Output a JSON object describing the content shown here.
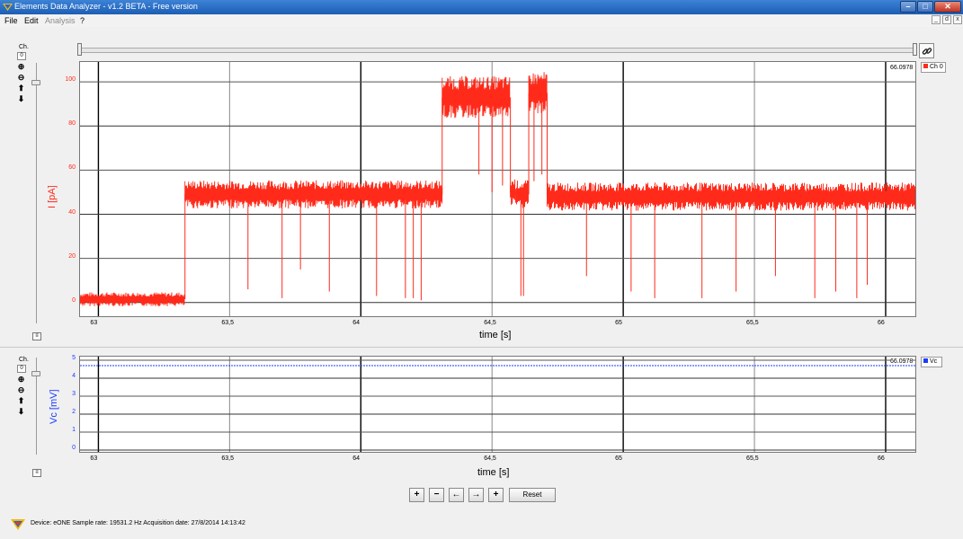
{
  "window": {
    "title": "Elements Data Analyzer - v1.2 BETA - Free version",
    "minimize": "–",
    "maximize": "□",
    "close": "✕"
  },
  "menu": [
    {
      "label": "File",
      "enabled": true
    },
    {
      "label": "Edit",
      "enabled": true
    },
    {
      "label": "Analysis",
      "enabled": false
    },
    {
      "label": "?",
      "enabled": true
    }
  ],
  "mdi": {
    "minimize": "_",
    "restore": "d",
    "close": "x"
  },
  "range_slider": {
    "link_icon": "link-icon"
  },
  "top_plot": {
    "channel_label": "Ch.",
    "channel_number": "0",
    "readout": "66.0978",
    "legend": "Ch 0",
    "color": "#ff2a1a",
    "corner_icon": "≡",
    "chart_data": {
      "type": "line",
      "xlabel": "time [s]",
      "ylabel": "I [pA]",
      "xlim": [
        62.93,
        66.12
      ],
      "ylim": [
        -7,
        109
      ],
      "xticks": [
        63,
        63.5,
        64,
        64.5,
        65,
        65.5,
        66
      ],
      "xtick_labels": [
        "63",
        "63,5",
        "64",
        "64,5",
        "65",
        "65,5",
        "66"
      ],
      "yticks": [
        0,
        20,
        40,
        60,
        80,
        100
      ],
      "ytick_labels": [
        "0",
        "20",
        "40",
        "60",
        "80",
        "100"
      ],
      "grid": true,
      "legend_position": "top-right",
      "series": [
        {
          "name": "Ch 0",
          "color": "#ff2a1a",
          "segments": [
            {
              "x": [
                62.93,
                63.33
              ],
              "level": 1.5,
              "noise": 2
            },
            {
              "x": [
                63.33,
                64.31
              ],
              "level": 49,
              "noise": 4
            },
            {
              "x": [
                64.31,
                64.57
              ],
              "level": 93,
              "noise": 6
            },
            {
              "x": [
                64.57,
                64.59
              ],
              "level": 50,
              "noise": 4
            },
            {
              "x": [
                64.59,
                64.64
              ],
              "level": 49,
              "noise": 4
            },
            {
              "x": [
                64.64,
                64.71
              ],
              "level": 95,
              "noise": 6
            },
            {
              "x": [
                64.71,
                66.12
              ],
              "level": 48,
              "noise": 4
            }
          ],
          "spikes": [
            {
              "x": 63.57,
              "y": 6
            },
            {
              "x": 63.7,
              "y": 2
            },
            {
              "x": 63.77,
              "y": 15
            },
            {
              "x": 63.88,
              "y": 5
            },
            {
              "x": 64.06,
              "y": 3
            },
            {
              "x": 64.17,
              "y": 2
            },
            {
              "x": 64.2,
              "y": 2
            },
            {
              "x": 64.23,
              "y": 1
            },
            {
              "x": 64.45,
              "y": 58
            },
            {
              "x": 64.5,
              "y": 50
            },
            {
              "x": 64.54,
              "y": 53
            },
            {
              "x": 64.61,
              "y": 3
            },
            {
              "x": 64.62,
              "y": 3
            },
            {
              "x": 64.66,
              "y": 55
            },
            {
              "x": 64.69,
              "y": 58
            },
            {
              "x": 64.86,
              "y": 12
            },
            {
              "x": 65.03,
              "y": 5
            },
            {
              "x": 65.12,
              "y": 2
            },
            {
              "x": 65.3,
              "y": 2
            },
            {
              "x": 65.43,
              "y": 5
            },
            {
              "x": 65.58,
              "y": 12
            },
            {
              "x": 65.73,
              "y": 2
            },
            {
              "x": 65.81,
              "y": 5
            },
            {
              "x": 65.89,
              "y": 2
            },
            {
              "x": 65.93,
              "y": 8
            }
          ]
        }
      ]
    }
  },
  "bottom_plot": {
    "channel_label": "Ch.",
    "channel_number": "0",
    "readout": "66.0978",
    "legend": "Vc",
    "color": "#1a3cff",
    "corner_icon": "≡",
    "chart_data": {
      "type": "line",
      "xlabel": "time [s]",
      "ylabel": "Vc [mV]",
      "xlim": [
        62.93,
        66.12
      ],
      "ylim": [
        -0.2,
        5.2
      ],
      "xticks": [
        63,
        63.5,
        64,
        64.5,
        65,
        65.5,
        66
      ],
      "xtick_labels": [
        "63",
        "63,5",
        "64",
        "64,5",
        "65",
        "65,5",
        "66"
      ],
      "yticks": [
        0,
        1,
        2,
        3,
        4,
        5
      ],
      "ytick_labels": [
        "0",
        "1",
        "2",
        "3",
        "4",
        "5"
      ],
      "grid": true,
      "legend_position": "top-right",
      "series": [
        {
          "name": "Vc",
          "color": "#1a3cff",
          "x": [
            62.93,
            66.12
          ],
          "y": [
            4.7,
            4.7
          ]
        }
      ]
    }
  },
  "nav": {
    "zoom_in_x": "+",
    "zoom_out_x": "−",
    "pan_left": "←",
    "pan_right": "→",
    "zoom_fit": "+",
    "reset": "Reset"
  },
  "status": {
    "text": "Device: eONE   Sample rate: 19531.2 Hz   Acquisition date: 27/8/2014 14:13:42"
  }
}
